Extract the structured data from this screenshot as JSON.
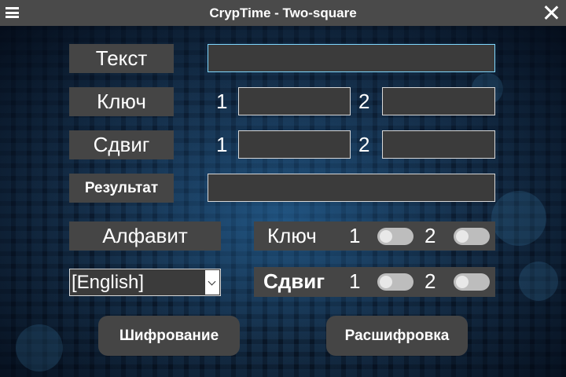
{
  "window": {
    "title": "CrypTime - Two-square"
  },
  "labels": {
    "text": "Текст",
    "key": "Ключ",
    "shift": "Сдвиг",
    "result": "Результат",
    "alphabet": "Алфавит"
  },
  "inputs": {
    "text_value": "",
    "key1_value": "",
    "key2_value": "",
    "shift1_value": "",
    "shift2_value": "",
    "result_value": ""
  },
  "numbers": {
    "one": "1",
    "two": "2"
  },
  "toggles": {
    "key_label": "Ключ",
    "shift_label": "Сдвиг",
    "key1_on": false,
    "key2_on": false,
    "shift1_on": false,
    "shift2_on": false
  },
  "alphabet_select": {
    "selected": "[English]"
  },
  "buttons": {
    "encrypt": "Шифрование",
    "decrypt": "Расшифровка"
  },
  "colors": {
    "panel": "#454545",
    "field": "#3b3b3b",
    "focus_border": "#7fd8ff",
    "titlebar": "#4a4a4a"
  },
  "icons": {
    "menu": "hamburger-menu-icon",
    "close": "close-icon"
  }
}
